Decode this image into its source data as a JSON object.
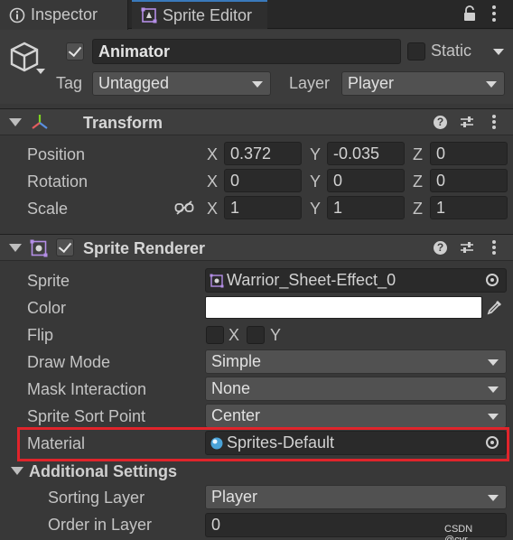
{
  "tabs": {
    "inspector": "Inspector",
    "sprite_editor": "Sprite Editor"
  },
  "gameobject": {
    "name": "Animator",
    "static_label": "Static",
    "tag_label": "Tag",
    "tag_value": "Untagged",
    "layer_label": "Layer",
    "layer_value": "Player"
  },
  "transform": {
    "title": "Transform",
    "position_label": "Position",
    "rotation_label": "Rotation",
    "scale_label": "Scale",
    "axis_x": "X",
    "axis_y": "Y",
    "axis_z": "Z",
    "position": {
      "x": "0.372",
      "y": "-0.035",
      "z": "0"
    },
    "rotation": {
      "x": "0",
      "y": "0",
      "z": "0"
    },
    "scale": {
      "x": "1",
      "y": "1",
      "z": "1"
    }
  },
  "sprite_renderer": {
    "title": "Sprite Renderer",
    "sprite_label": "Sprite",
    "sprite_value": "Warrior_Sheet-Effect_0",
    "color_label": "Color",
    "color_value": "#ffffff",
    "flip_label": "Flip",
    "flip_x": "X",
    "flip_y": "Y",
    "draw_mode_label": "Draw Mode",
    "draw_mode_value": "Simple",
    "mask_label": "Mask Interaction",
    "mask_value": "None",
    "sort_point_label": "Sprite Sort Point",
    "sort_point_value": "Center",
    "material_label": "Material",
    "material_value": "Sprites-Default",
    "additional_title": "Additional Settings",
    "sorting_layer_label": "Sorting Layer",
    "sorting_layer_value": "Player",
    "order_label": "Order in Layer",
    "order_value": "0"
  },
  "watermark": "CSDN @cyr___",
  "colors": {
    "highlight": "#e0242b",
    "accent": "#3a79bb",
    "panel": "#383838"
  }
}
